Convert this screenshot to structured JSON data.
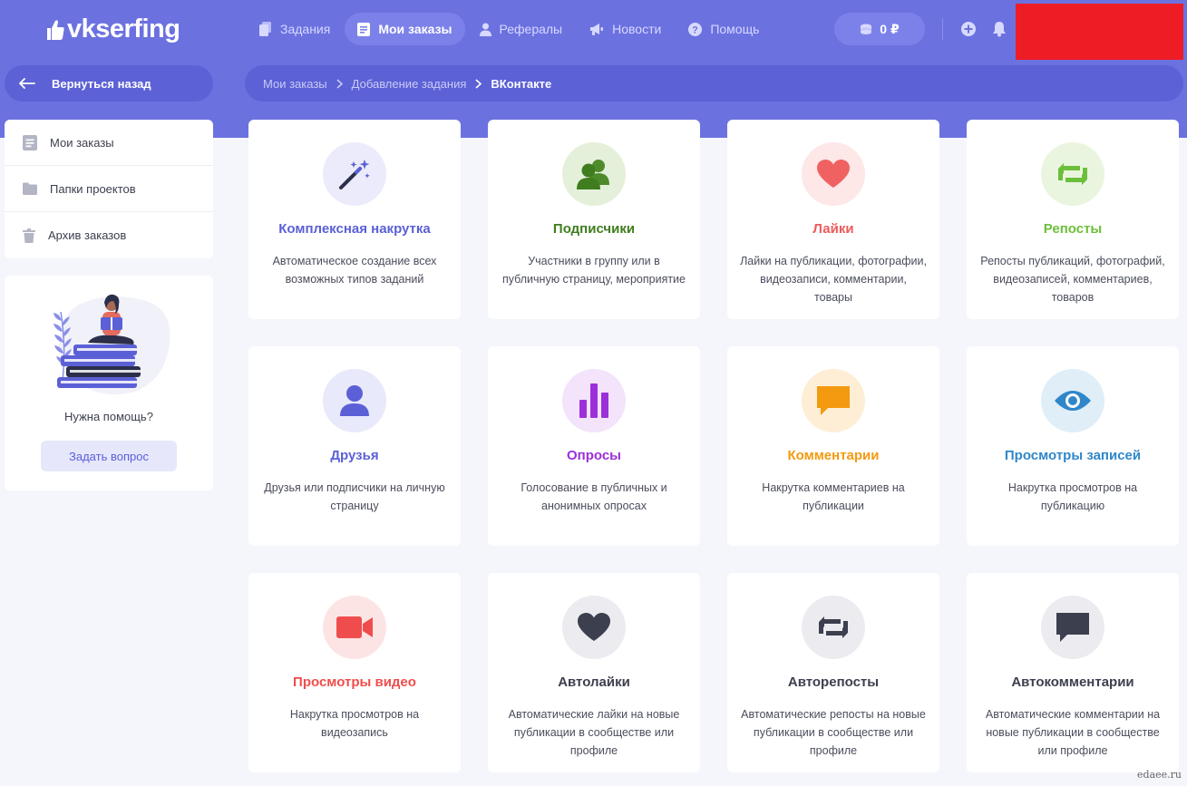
{
  "header": {
    "logo": "vkserfing",
    "nav": [
      {
        "label": "Задания",
        "icon": "copy-icon"
      },
      {
        "label": "Мои заказы",
        "icon": "document-icon",
        "active": true
      },
      {
        "label": "Рефералы",
        "icon": "user-icon"
      },
      {
        "label": "Новости",
        "icon": "megaphone-icon"
      },
      {
        "label": "Помощь",
        "icon": "help-icon"
      }
    ],
    "balance": "0 ₽"
  },
  "back": {
    "label": "Вернуться назад"
  },
  "breadcrumb": [
    "Мои заказы",
    "Добавление задания",
    "ВКонтакте"
  ],
  "sidebar": {
    "items": [
      {
        "label": "Мои заказы",
        "icon": "document-icon"
      },
      {
        "label": "Папки проектов",
        "icon": "folder-icon"
      },
      {
        "label": "Архив заказов",
        "icon": "trash-icon"
      }
    ],
    "help_title": "Нужна помощь?",
    "help_button": "Задать вопрос"
  },
  "cards": [
    {
      "title": "Комплексная накрутка",
      "desc": "Автоматическое создание всех возможных типов заданий",
      "icon": "magic-wand-icon",
      "color": "#5b60d6"
    },
    {
      "title": "Подписчики",
      "desc": "Участники в группу или в публичную страницу, мероприятие",
      "icon": "users-icon",
      "color": "#3f7d1f"
    },
    {
      "title": "Лайки",
      "desc": "Лайки на публикации, фотографии, видеозаписи, комментарии, товары",
      "icon": "heart-icon",
      "color": "#ef5a5a"
    },
    {
      "title": "Репосты",
      "desc": "Репосты публикаций, фотографий, видеозаписей, комментариев, товаров",
      "icon": "repost-icon",
      "color": "#6cbf3a"
    },
    {
      "title": "Друзья",
      "desc": "Друзья или подписчики на личную страницу",
      "icon": "person-icon",
      "color": "#5b60d6"
    },
    {
      "title": "Опросы",
      "desc": "Голосование в публичных и анонимных опросах",
      "icon": "bar-chart-icon",
      "color": "#9b30d9"
    },
    {
      "title": "Комментарии",
      "desc": "Накрутка комментариев на публикации",
      "icon": "comment-icon",
      "color": "#f39a10"
    },
    {
      "title": "Просмотры записей",
      "desc": "Накрутка просмотров на публикацию",
      "icon": "eye-icon",
      "color": "#2f87c9"
    },
    {
      "title": "Просмотры видео",
      "desc": "Накрутка просмотров на видеозапись",
      "icon": "video-camera-icon",
      "color": "#ef4d4d"
    },
    {
      "title": "Автолайки",
      "desc": "Автоматические лайки на новые публикации в сообществе или профиле",
      "icon": "heart-icon",
      "color": "#3c3f4e"
    },
    {
      "title": "Авторепосты",
      "desc": "Автоматические репосты на новые публикации в сообществе или профиле",
      "icon": "repost-icon",
      "color": "#3c3f4e"
    },
    {
      "title": "Автокомментарии",
      "desc": "Автоматические комментарии на новые публикации в сообществе или профиле",
      "icon": "comment-icon",
      "color": "#3c3f4e"
    }
  ],
  "watermark": "edaee.ru"
}
